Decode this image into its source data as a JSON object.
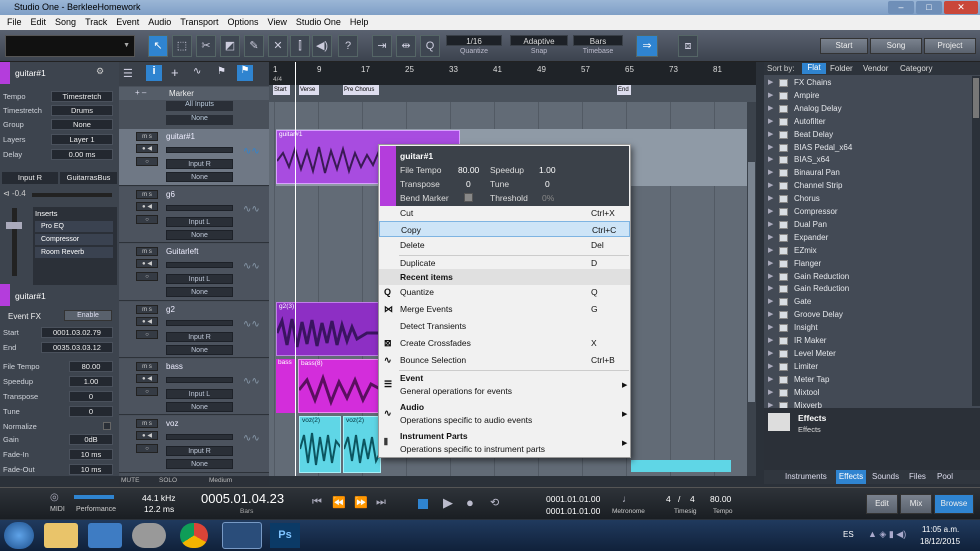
{
  "window": {
    "title": "Studio One - BerkleeHomework"
  },
  "menu": [
    "File",
    "Edit",
    "Song",
    "Track",
    "Event",
    "Audio",
    "Transport",
    "Options",
    "View",
    "Studio One",
    "Help"
  ],
  "toolbar": {
    "quantize_value": "1/16",
    "quantize_label": "Quantize",
    "snap_value": "Adaptive",
    "snap_label": "Snap",
    "timebase_value": "Bars",
    "timebase_label": "Timebase",
    "start": "Start",
    "song": "Song",
    "project": "Project"
  },
  "inspector": {
    "track_name": "guitar#1",
    "rows": [
      {
        "label": "Tempo",
        "value": "Timestretch"
      },
      {
        "label": "Timestretch",
        "value": "Drums"
      },
      {
        "label": "Group",
        "value": "None"
      },
      {
        "label": "Layers",
        "value": "Layer 1"
      },
      {
        "label": "Delay",
        "value": "0.00 ms"
      }
    ],
    "input": "Input R",
    "output": "GuitarrasBus",
    "pan": "-0.4",
    "inserts_label": "Inserts",
    "inserts": [
      "Pro EQ",
      "Compressor",
      "Room Reverb"
    ],
    "event_name": "guitar#1",
    "event_fx": "Event FX",
    "enable": "Enable",
    "event_rows": [
      {
        "label": "Start",
        "value": "0001.03.02.79"
      },
      {
        "label": "End",
        "value": "0035.03.03.12"
      }
    ],
    "event_rows2": [
      {
        "label": "File Tempo",
        "value": "80.00"
      },
      {
        "label": "Speedup",
        "value": "1.00"
      },
      {
        "label": "Transpose",
        "value": "0"
      },
      {
        "label": "Tune",
        "value": "0"
      },
      {
        "label": "Normalize",
        "value": ""
      },
      {
        "label": "Gain",
        "value": "0dB"
      },
      {
        "label": "Fade-In",
        "value": "10 ms"
      },
      {
        "label": "Fade-Out",
        "value": "10 ms"
      }
    ]
  },
  "tracklist": {
    "marker_label": "Marker",
    "all_inputs": "All Inputs",
    "none": "None",
    "tracks": [
      {
        "name": "guitar#1",
        "input": "Input R",
        "out": "None"
      },
      {
        "name": "g6",
        "input": "Input L",
        "out": "None"
      },
      {
        "name": "Guitarleft",
        "input": "Input L",
        "out": "None"
      },
      {
        "name": "g2",
        "input": "Input R",
        "out": "None"
      },
      {
        "name": "bass",
        "input": "Input L",
        "out": "None"
      },
      {
        "name": "voz",
        "input": "Input R",
        "out": "None"
      }
    ],
    "mute": "MUTE",
    "solo": "SOLO",
    "size": "Medium"
  },
  "ruler": {
    "bars": [
      "1",
      "9",
      "17",
      "25",
      "33",
      "41",
      "49",
      "57",
      "65",
      "73",
      "81"
    ],
    "sig": "4/4",
    "markers": [
      "Start",
      "Verse",
      "Pre Chorus",
      "End"
    ]
  },
  "clips": [
    {
      "name": "guitar#1"
    },
    {
      "name": "g2(3)"
    },
    {
      "name": "bass"
    },
    {
      "name": "bass(8)"
    },
    {
      "name": "voz(2)"
    },
    {
      "name": "voz(2)"
    }
  ],
  "context_menu": {
    "header": {
      "name": "guitar#1",
      "file_tempo_label": "File Tempo",
      "file_tempo": "80.00",
      "speedup_label": "Speedup",
      "speedup": "1.00",
      "transpose_label": "Transpose",
      "transpose": "0",
      "tune_label": "Tune",
      "tune": "0",
      "bend_label": "Bend Marker",
      "threshold_label": "Threshold",
      "threshold": "0%"
    },
    "items": [
      {
        "label": "Cut",
        "key": "Ctrl+X"
      },
      {
        "label": "Copy",
        "key": "Ctrl+C"
      },
      {
        "label": "Delete",
        "key": "Del"
      },
      {
        "label": "Duplicate",
        "key": "D"
      }
    ],
    "recent": "Recent items",
    "recent_items": [
      {
        "label": "Quantize",
        "key": "Q"
      },
      {
        "label": "Merge Events",
        "key": "G"
      },
      {
        "label": "Detect Transients",
        "key": ""
      },
      {
        "label": "Create Crossfades",
        "key": "X"
      },
      {
        "label": "Bounce Selection",
        "key": "Ctrl+B"
      }
    ],
    "submenus": [
      {
        "title": "Event",
        "desc": "General operations for events"
      },
      {
        "title": "Audio",
        "desc": "Operations specific to audio events"
      },
      {
        "title": "Instrument Parts",
        "desc": "Operations specific to instrument parts"
      }
    ]
  },
  "browser": {
    "sort_by": "Sort by:",
    "tabs": [
      "Flat",
      "Folder",
      "Vendor",
      "Category"
    ],
    "items": [
      "FX Chains",
      "Ampire",
      "Analog Delay",
      "Autofilter",
      "Beat Delay",
      "BIAS Pedal_x64",
      "BIAS_x64",
      "Binaural Pan",
      "Channel Strip",
      "Chorus",
      "Compressor",
      "Dual Pan",
      "Expander",
      "EZmix",
      "Flanger",
      "Gain Reduction",
      "Gain Reduction",
      "Gate",
      "Groove Delay",
      "Insight",
      "IR Maker",
      "Level Meter",
      "Limiter",
      "Meter Tap",
      "Mixtool",
      "Mixverb"
    ],
    "effects_title": "Effects",
    "effects_sub": "Effects",
    "bottom_tabs": [
      "Instruments",
      "Effects",
      "Sounds",
      "Files",
      "Pool"
    ]
  },
  "transport": {
    "midi": "MIDI",
    "performance": "Performance",
    "sample_rate": "44.1 kHz",
    "latency": "12.2 ms",
    "position": "0005.01.04.23",
    "pos_unit": "Bars",
    "loop_start": "0001.01.01.00",
    "loop_end": "0001.01.01.00",
    "metronome": "Metronome",
    "timesig_num": "4",
    "timesig_den": "4",
    "timesig_label": "Timesig",
    "tempo": "80.00",
    "tempo_label": "Tempo",
    "edit": "Edit",
    "mix": "Mix",
    "browse": "Browse"
  },
  "taskbar": {
    "lang": "ES",
    "time": "11:05 a.m.",
    "date": "18/12/2015"
  },
  "colors": {
    "accent": "#2f84d0",
    "event_purple": "#b43ddc",
    "audio_cyan": "#5fd6e6"
  }
}
